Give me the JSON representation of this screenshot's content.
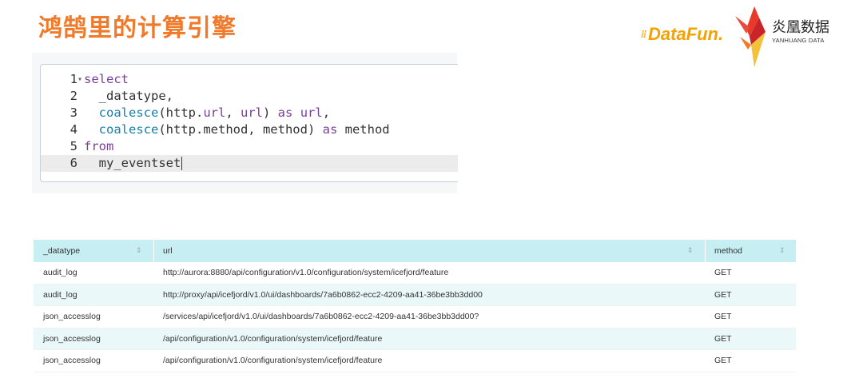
{
  "header": {
    "title": "鸿鹄里的计算引擎",
    "logo_datafun": "DataFun.",
    "logo_yanhuang_cn": "炎凰数据",
    "logo_yanhuang_en": "YANHUANG DATA"
  },
  "editor": {
    "lines": [
      {
        "num": "1",
        "fold": "▾",
        "tokens": [
          {
            "t": "select",
            "c": "kw"
          }
        ]
      },
      {
        "num": "2",
        "fold": "",
        "tokens": [
          {
            "t": "  _datatype,",
            "c": ""
          }
        ]
      },
      {
        "num": "3",
        "fold": "",
        "tokens": [
          {
            "t": "  ",
            "c": ""
          },
          {
            "t": "coalesce",
            "c": "fn"
          },
          {
            "t": "(http.",
            "c": ""
          },
          {
            "t": "url",
            "c": "var"
          },
          {
            "t": ", ",
            "c": ""
          },
          {
            "t": "url",
            "c": "var"
          },
          {
            "t": ") ",
            "c": ""
          },
          {
            "t": "as",
            "c": "kw"
          },
          {
            "t": " ",
            "c": ""
          },
          {
            "t": "url",
            "c": "var"
          },
          {
            "t": ",",
            "c": ""
          }
        ]
      },
      {
        "num": "4",
        "fold": "",
        "tokens": [
          {
            "t": "  ",
            "c": ""
          },
          {
            "t": "coalesce",
            "c": "fn"
          },
          {
            "t": "(http.method, method) ",
            "c": ""
          },
          {
            "t": "as",
            "c": "kw"
          },
          {
            "t": " method",
            "c": ""
          }
        ]
      },
      {
        "num": "5",
        "fold": "",
        "tokens": [
          {
            "t": "from",
            "c": "kw"
          }
        ]
      },
      {
        "num": "6",
        "fold": "",
        "tokens": [
          {
            "t": "  my_eventset",
            "c": ""
          }
        ],
        "active": true
      }
    ]
  },
  "table": {
    "columns": [
      "_datatype",
      "url",
      "method"
    ],
    "sort_icon": "⇕",
    "rows": [
      [
        "audit_log",
        "http://aurora:8880/api/configuration/v1.0/configuration/system/icefjord/feature",
        "GET"
      ],
      [
        "audit_log",
        "http://proxy/api/icefjord/v1.0/ui/dashboards/7a6b0862-ecc2-4209-aa41-36be3bb3dd00",
        "GET"
      ],
      [
        "json_accesslog",
        "/services/api/icefjord/v1.0/ui/dashboards/7a6b0862-ecc2-4209-aa41-36be3bb3dd00?",
        "GET"
      ],
      [
        "json_accesslog",
        "/api/configuration/v1.0/configuration/system/icefjord/feature",
        "GET"
      ],
      [
        "json_accesslog",
        "/api/configuration/v1.0/configuration/system/icefjord/feature",
        "GET"
      ]
    ]
  }
}
